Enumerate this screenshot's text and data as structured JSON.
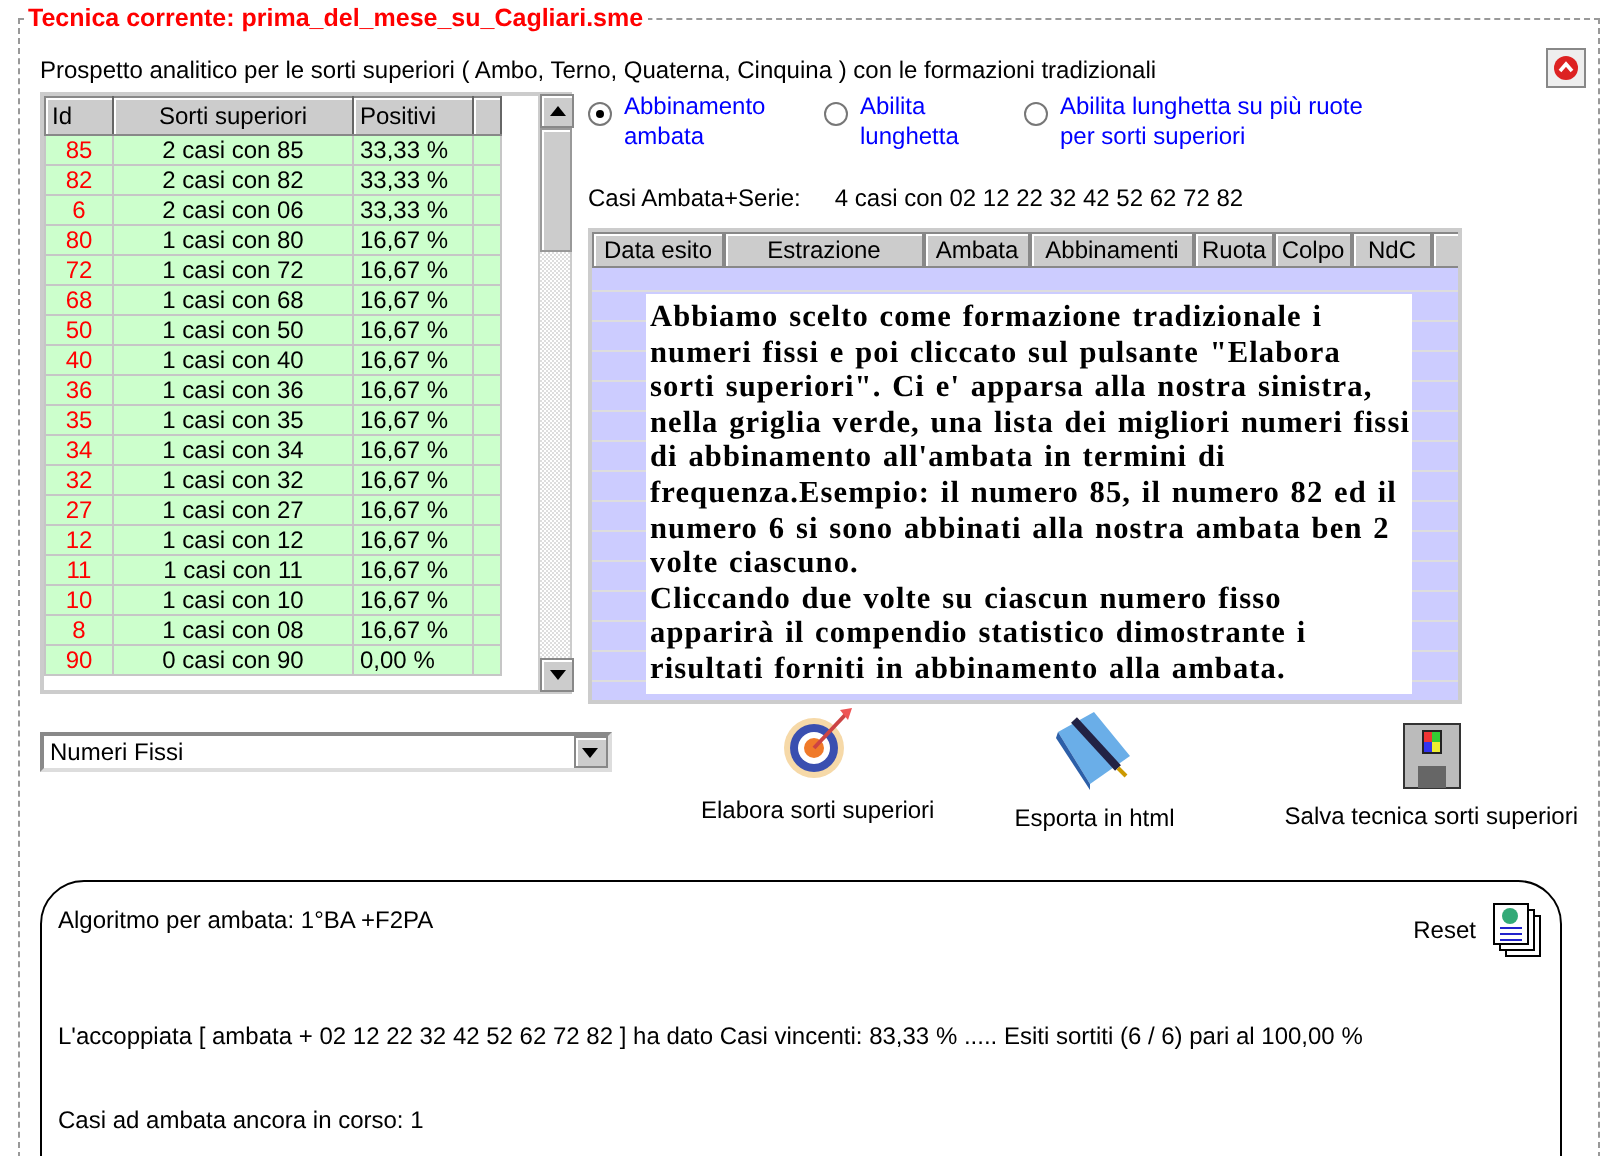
{
  "legend": "Tecnica corrente: prima_del_mese_su_Cagliari.sme",
  "subtitle": "Prospetto analitico per le sorti superiori ( Ambo, Terno, Quaterna, Cinquina ) con le formazioni tradizionali",
  "left_grid": {
    "columns": [
      "Id",
      "Sorti superiori",
      "Positivi"
    ],
    "rows": [
      [
        "85",
        "2 casi con 85",
        "33,33 %"
      ],
      [
        "82",
        "2 casi con 82",
        "33,33 %"
      ],
      [
        "6",
        "2 casi con 06",
        "33,33 %"
      ],
      [
        "80",
        "1 casi con 80",
        "16,67 %"
      ],
      [
        "72",
        "1 casi con 72",
        "16,67 %"
      ],
      [
        "68",
        "1 casi con 68",
        "16,67 %"
      ],
      [
        "50",
        "1 casi con 50",
        "16,67 %"
      ],
      [
        "40",
        "1 casi con 40",
        "16,67 %"
      ],
      [
        "36",
        "1 casi con 36",
        "16,67 %"
      ],
      [
        "35",
        "1 casi con 35",
        "16,67 %"
      ],
      [
        "34",
        "1 casi con 34",
        "16,67 %"
      ],
      [
        "32",
        "1 casi con 32",
        "16,67 %"
      ],
      [
        "27",
        "1 casi con 27",
        "16,67 %"
      ],
      [
        "12",
        "1 casi con 12",
        "16,67 %"
      ],
      [
        "11",
        "1 casi con 11",
        "16,67 %"
      ],
      [
        "10",
        "1 casi con 10",
        "16,67 %"
      ],
      [
        "8",
        "1 casi con 08",
        "16,67 %"
      ],
      [
        "90",
        "0 casi con 90",
        "0,00 %"
      ]
    ]
  },
  "radios": [
    {
      "label": "Abbinamento ambata",
      "selected": true
    },
    {
      "label": "Abilita lunghetta",
      "selected": false
    },
    {
      "label": "Abilita lunghetta su più ruote per sorti superiori",
      "selected": false
    }
  ],
  "casi_label": "Casi Ambata+Serie:",
  "casi_value": "4 casi con 02 12 22 32 42 52 62 72 82",
  "right_grid": {
    "columns": [
      "Data esito",
      "Estrazione",
      "Ambata",
      "Abbinamenti",
      "Ruota",
      "Colpo",
      "NdC"
    ]
  },
  "note": "Abbiamo scelto come formazione tradizionale i numeri fissi e poi cliccato sul pulsante \"Elabora sorti superiori\". Ci e' apparsa alla nostra sinistra, nella griglia verde, una lista dei migliori numeri fissi  di abbinamento all'ambata in termini di frequenza.Esempio: il numero 85, il numero 82 ed il numero 6 si sono abbinati alla nostra ambata ben 2 volte ciascuno.\nCliccando due volte su ciascun numero fisso apparirà il compendio statistico dimostrante i risultati forniti in abbinamento alla ambata.",
  "dropdown": {
    "value": "Numeri Fissi"
  },
  "actions": [
    {
      "kind": "target",
      "label": "Elabora sorti superiori"
    },
    {
      "kind": "book",
      "label": "Esporta in html"
    },
    {
      "kind": "floppy",
      "label": "Salva tecnica sorti superiori"
    }
  ],
  "result": {
    "algorithm": "Algoritmo per ambata: 1°BA +F2PA",
    "reset": "Reset",
    "summary": "L'accoppiata [ ambata + 02 12 22 32 42 52 62 72 82 ] ha dato  Casi vincenti: 83,33 % ..... Esiti sortiti (6 / 6) pari al 100,00 %",
    "pending": "Casi ad ambata ancora in corso:  1"
  }
}
